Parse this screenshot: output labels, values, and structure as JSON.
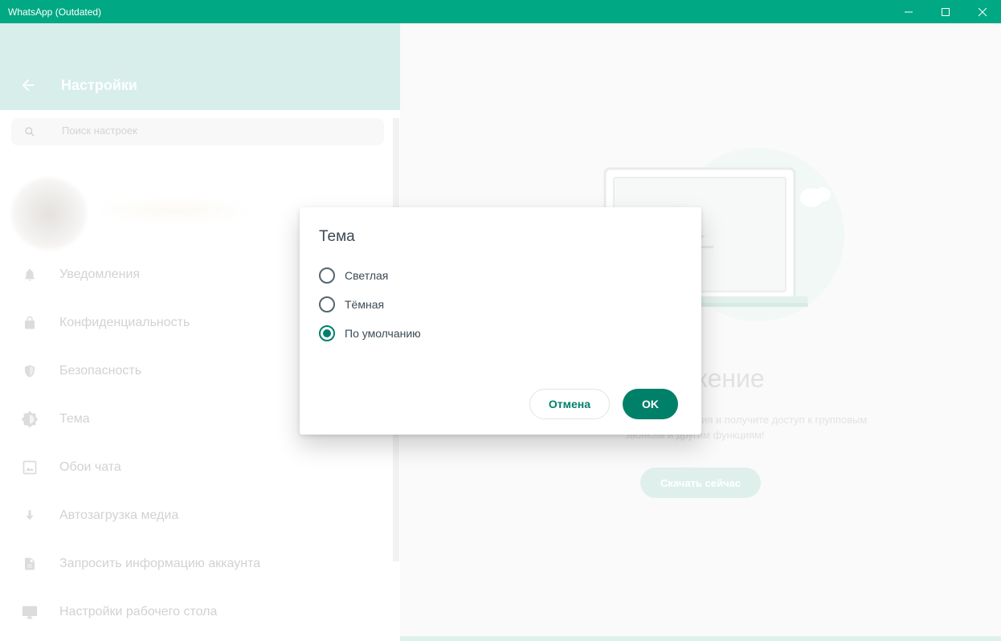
{
  "window": {
    "title": "WhatsApp (Outdated)"
  },
  "sidebar": {
    "title": "Настройки",
    "search_placeholder": "Поиск настроек",
    "items": [
      {
        "label": "Уведомления",
        "icon": "bell-icon"
      },
      {
        "label": "Конфиденциальность",
        "icon": "lock-icon"
      },
      {
        "label": "Безопасность",
        "icon": "shield-icon"
      },
      {
        "label": "Тема",
        "icon": "theme-icon"
      },
      {
        "label": "Обои чата",
        "icon": "wallpaper-icon"
      },
      {
        "label": "Автозагрузка медиа",
        "icon": "download-icon"
      },
      {
        "label": "Запросить информацию аккаунта",
        "icon": "document-icon"
      },
      {
        "label": "Настройки рабочего стола",
        "icon": "monitor-icon"
      }
    ]
  },
  "main": {
    "title": "е приложение",
    "description_line1": "жения и получите доступ к групповым",
    "description_line2": "звонкам и другим функциям!",
    "download_button": "Скачать сейчас"
  },
  "dialog": {
    "title": "Тема",
    "options": [
      {
        "label": "Светлая",
        "selected": false
      },
      {
        "label": "Тёмная",
        "selected": false
      },
      {
        "label": "По умолчанию",
        "selected": true
      }
    ],
    "cancel_label": "Отмена",
    "ok_label": "OK"
  },
  "colors": {
    "accent": "#008069",
    "titlebar": "#00a884",
    "header": "#d7eeea"
  }
}
